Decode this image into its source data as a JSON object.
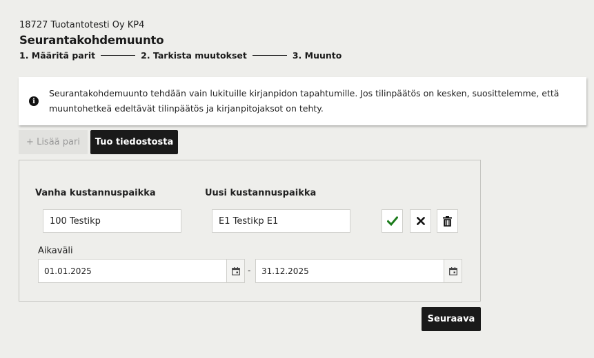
{
  "header": {
    "company": "18727 Tuotantotesti Oy KP4",
    "title": "Seurantakohdemuunto"
  },
  "steps": [
    {
      "label": "1. Määritä parit"
    },
    {
      "label": "2. Tarkista muutokset"
    },
    {
      "label": "3. Muunto"
    }
  ],
  "info": {
    "icon": "info-icon",
    "text": "Seurantakohdemuunto tehdään vain lukituille kirjanpidon tapahtumille. Jos tilinpäätös on kesken, suosittelemme, että muuntohetkeä edeltävät tilinpäätös ja kirjanpitojaksot on tehty."
  },
  "toolbar": {
    "add_pair_label": "+ Lisää pari",
    "import_label": "Tuo tiedostosta"
  },
  "pair": {
    "old_label": "Vanha kustannuspaikka",
    "new_label": "Uusi kustannuspaikka",
    "old_value": "100 Testikp",
    "new_value": "E1 Testikp E1",
    "period_label": "Aikaväli",
    "start_date": "01.01.2025",
    "end_date": "31.12.2025",
    "separator": "-"
  },
  "footer": {
    "next_label": "Seuraava"
  },
  "colors": {
    "background": "#eeeeeb",
    "dark_button": "#1a1a1a",
    "confirm_green": "#1a7a1a"
  }
}
